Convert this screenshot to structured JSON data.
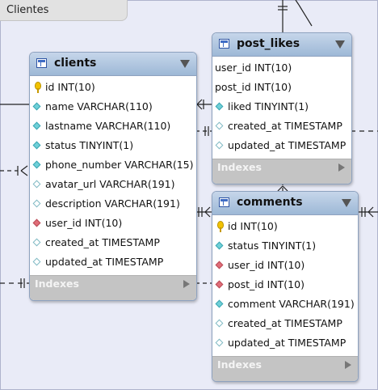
{
  "group": {
    "title": "Clientes"
  },
  "tables": {
    "clients": {
      "name": "clients",
      "columns": [
        {
          "icon": "primary-key-icon",
          "text": "id INT(10)"
        },
        {
          "icon": "not-null-column-icon",
          "text": "name VARCHAR(110)"
        },
        {
          "icon": "not-null-column-icon",
          "text": "lastname VARCHAR(110)"
        },
        {
          "icon": "not-null-column-icon",
          "text": "status TINYINT(1)"
        },
        {
          "icon": "not-null-column-icon",
          "text": "phone_number VARCHAR(15)"
        },
        {
          "icon": "nullable-column-icon",
          "text": "avatar_url VARCHAR(191)"
        },
        {
          "icon": "nullable-column-icon",
          "text": "description VARCHAR(191)"
        },
        {
          "icon": "foreign-key-icon",
          "text": "user_id INT(10)"
        },
        {
          "icon": "nullable-column-icon",
          "text": "created_at TIMESTAMP"
        },
        {
          "icon": "nullable-column-icon",
          "text": "updated_at TIMESTAMP"
        }
      ],
      "footer": "Indexes"
    },
    "post_likes": {
      "name": "post_likes",
      "columns": [
        {
          "icon": "none",
          "text": "user_id INT(10)"
        },
        {
          "icon": "none",
          "text": "post_id INT(10)"
        },
        {
          "icon": "not-null-column-icon",
          "text": "liked TINYINT(1)"
        },
        {
          "icon": "nullable-column-icon",
          "text": "created_at TIMESTAMP"
        },
        {
          "icon": "nullable-column-icon",
          "text": "updated_at TIMESTAMP"
        }
      ],
      "footer": "Indexes"
    },
    "comments": {
      "name": "comments",
      "columns": [
        {
          "icon": "primary-key-icon",
          "text": "id INT(10)"
        },
        {
          "icon": "not-null-column-icon",
          "text": "status TINYINT(1)"
        },
        {
          "icon": "foreign-key-icon",
          "text": "user_id INT(10)"
        },
        {
          "icon": "foreign-key-icon",
          "text": "post_id INT(10)"
        },
        {
          "icon": "not-null-column-icon",
          "text": "comment VARCHAR(191)"
        },
        {
          "icon": "nullable-column-icon",
          "text": "created_at TIMESTAMP"
        },
        {
          "icon": "nullable-column-icon",
          "text": "updated_at TIMESTAMP"
        }
      ],
      "footer": "Indexes"
    }
  }
}
